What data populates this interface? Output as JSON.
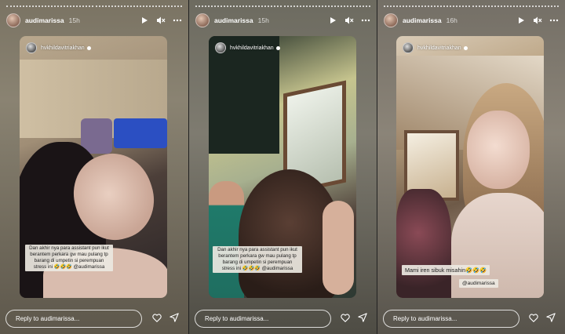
{
  "stories": [
    {
      "username": "audimarissa",
      "time": "15h",
      "card_username": "hvkhildavitriakhan",
      "caption": [
        "Dan akhir nya para assistant pun ikut",
        "berantem perkara gw mau pulang tp",
        "barang di umpetin si perempuan",
        "stress ini 🤣🤣🤣 @audimarissa"
      ],
      "mention": "",
      "big_caption": "",
      "reply_placeholder": "Reply to audimarissa..."
    },
    {
      "username": "audimarissa",
      "time": "15h",
      "card_username": "hvkhildavitriakhan",
      "caption": [
        "Dan akhir nya para assistant pun ikut",
        "berantem perkara gw mau pulang tp",
        "barang di umpetin si perempuan",
        "stress ini 🤣🤣🤣 @audimarissa"
      ],
      "mention": "",
      "big_caption": "",
      "reply_placeholder": "Reply to audimarissa..."
    },
    {
      "username": "audimarissa",
      "time": "16h",
      "card_username": "hvkhildavitriakhan",
      "caption": [],
      "mention": "@audimarissa",
      "big_caption": "Mami iren sibuk misahin🤣🤣🤣",
      "reply_placeholder": "Reply to audimarissa..."
    }
  ],
  "icons": {
    "play": "play-icon",
    "mute": "mute-icon",
    "more": "more-icon",
    "like": "heart-icon",
    "share": "send-icon"
  }
}
